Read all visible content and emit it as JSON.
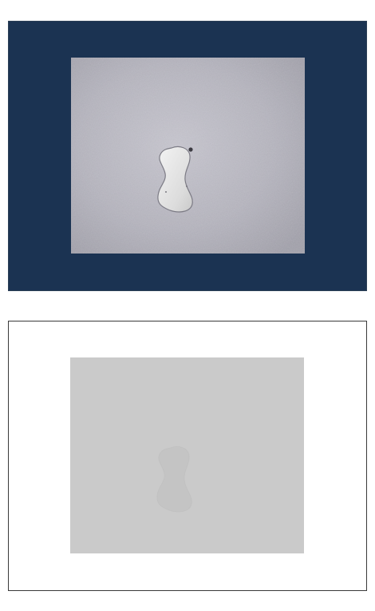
{
  "figure": {
    "top_panel": {
      "name": "photograph",
      "background_color": "#1b3352",
      "plate_color": "#b9b8c1",
      "hole_color": "#e6e6e6"
    },
    "bottom_panel": {
      "name": "processed-image",
      "background_color": "#ffffff",
      "plate_color": "#cacaca",
      "hole_color": "#c4c4c4"
    }
  }
}
